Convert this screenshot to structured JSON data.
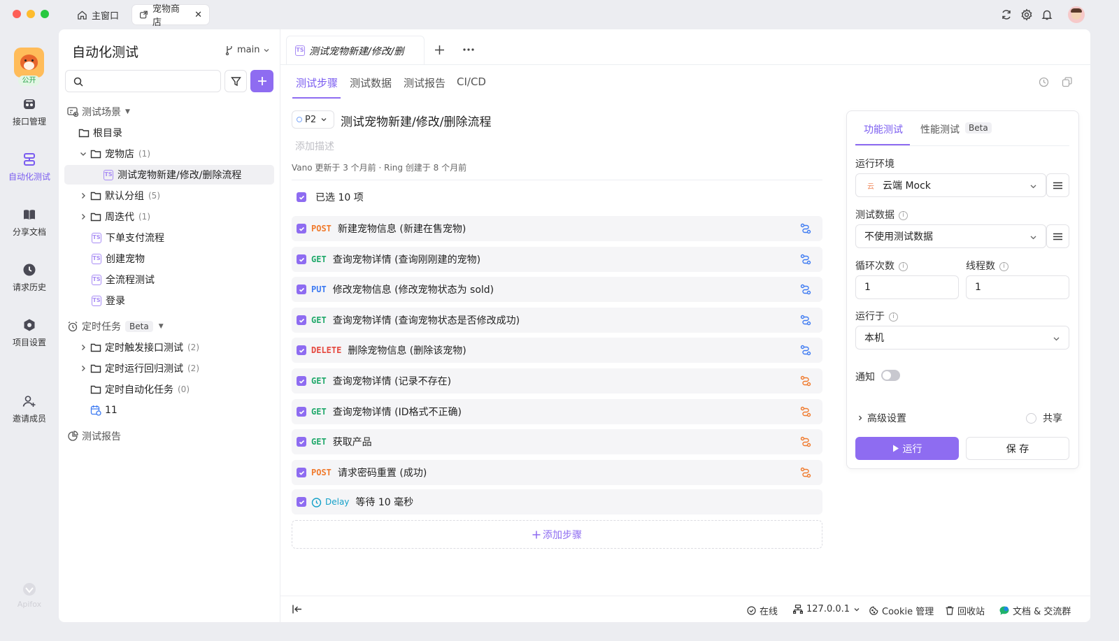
{
  "titlebar": {
    "home_tab": "主窗口",
    "project_tab": "宠物商店",
    "colors": {
      "close": "#fe5f57",
      "minimize": "#febc2e",
      "maximize": "#28c840"
    }
  },
  "rail": {
    "public_badge": "公开",
    "items": [
      {
        "label": "接口管理",
        "icon": "api-icon"
      },
      {
        "label": "自动化测试",
        "icon": "automation-icon"
      },
      {
        "label": "分享文档",
        "icon": "book-icon"
      },
      {
        "label": "请求历史",
        "icon": "clock-icon"
      },
      {
        "label": "项目设置",
        "icon": "settings-icon"
      },
      {
        "label": "邀请成员",
        "icon": "invite-icon"
      }
    ],
    "brand": "Apifox"
  },
  "sidebar": {
    "title": "自动化测试",
    "branch": "main",
    "scenes_label": "测试场景",
    "tree": [
      {
        "label": "根目录"
      },
      {
        "label": "宠物店",
        "count": "(1)"
      },
      {
        "label": "测试宠物新建/修改/删除流程"
      },
      {
        "label": "默认分组",
        "count": "(5)"
      },
      {
        "label": "周迭代",
        "count": "(1)"
      },
      {
        "label": "下单支付流程"
      },
      {
        "label": "创建宠物"
      },
      {
        "label": "全流程测试"
      },
      {
        "label": "登录"
      }
    ],
    "scheduled_label": "定时任务",
    "scheduled_badge": "Beta",
    "scheduled": [
      {
        "label": "定时触发接口测试",
        "count": "(2)"
      },
      {
        "label": "定时运行回归测试",
        "count": "(2)"
      },
      {
        "label": "定时自动化任务",
        "count": "(0)"
      },
      {
        "label": "11"
      }
    ],
    "report_label": "测试报告"
  },
  "main": {
    "doc_tab": "测试宠物新建/修改/删",
    "sub_tabs": [
      "测试步骤",
      "测试数据",
      "测试报告",
      "CI/CD"
    ],
    "priority": "P2",
    "scenario_title": "测试宠物新建/修改/删除流程",
    "desc_placeholder": "添加描述",
    "meta": "Vano 更新于 3 个月前 · Ring 创建于 8 个月前",
    "selected_text": "已选 10 项",
    "steps": [
      {
        "method": "POST",
        "text": "新建宠物信息 (新建在售宠物)",
        "link": "blue"
      },
      {
        "method": "GET",
        "text": "查询宠物详情 (查询刚刚建的宠物)",
        "link": "blue"
      },
      {
        "method": "PUT",
        "text": "修改宠物信息 (修改宠物状态为 sold)",
        "link": "blue"
      },
      {
        "method": "GET",
        "text": "查询宠物详情 (查询宠物状态是否修改成功)",
        "link": "blue"
      },
      {
        "method": "DELETE",
        "text": "删除宠物信息 (删除该宠物)",
        "link": "blue"
      },
      {
        "method": "GET",
        "text": "查询宠物详情 (记录不存在)",
        "link": "orange"
      },
      {
        "method": "GET",
        "text": "查询宠物详情 (ID格式不正确)",
        "link": "orange"
      },
      {
        "method": "GET",
        "text": "获取产品",
        "link": "orange"
      },
      {
        "method": "POST",
        "text": "请求密码重置 (成功)",
        "link": "orange"
      }
    ],
    "delay_label": "Delay",
    "delay_text": "等待 10 毫秒",
    "add_step": "添加步骤"
  },
  "config": {
    "tab_func": "功能测试",
    "tab_perf": "性能测试",
    "tab_perf_badge": "Beta",
    "env_label": "运行环境",
    "env_value": "云端 Mock",
    "env_badge": "云",
    "data_label": "测试数据",
    "data_value": "不使用测试数据",
    "loop_label": "循环次数",
    "loop_value": "1",
    "thread_label": "线程数",
    "thread_value": "1",
    "runon_label": "运行于",
    "runon_value": "本机",
    "notify_label": "通知",
    "advanced_label": "高级设置",
    "share_label": "共享",
    "run_button": "运行",
    "save_button": "保 存",
    "accent": "#8e6cf1"
  },
  "statusbar": {
    "online": "在线",
    "ip": "127.0.0.1",
    "cookie": "Cookie 管理",
    "trash": "回收站",
    "docs": "文档 & 交流群"
  }
}
